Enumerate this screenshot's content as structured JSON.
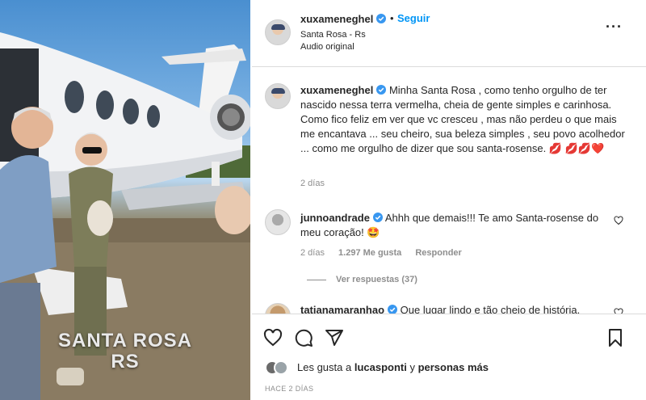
{
  "photo": {
    "overlay_line1": "SANTA ROSA",
    "overlay_line2": "RS"
  },
  "header": {
    "username": "xuxameneghel",
    "dot": "•",
    "follow_label": "Seguir",
    "location": "Santa Rosa - Rs",
    "audio": "Audio original",
    "more_label": "···"
  },
  "caption": {
    "username": "xuxameneghel",
    "text": " Minha Santa Rosa , como tenho orgulho de ter nascido nessa terra vermelha, cheia de gente simples e carinhosa. Como fico feliz em ver que vc cresceu , mas não perdeu o que mais me encantava ... seu cheiro, sua beleza simples , seu povo acolhedor ... como me orgulho de dizer que sou santa-rosense. 💋 💋💋❤️",
    "time": "2 días"
  },
  "comments": [
    {
      "username": "junnoandrade",
      "text": " Ahhh que demais!!! Te amo Santa-rosense do meu coração! 🤩",
      "time": "2 días",
      "likes": "1.297 Me gusta",
      "reply_label": "Responder",
      "view_replies": "Ver respuestas (37)"
    },
    {
      "username": "tatianamaranhao",
      "text": " Que lugar lindo e tão cheio de história."
    }
  ],
  "likes": {
    "prefix": "Les gusta a ",
    "user": "lucasponti",
    "middle": " y ",
    "rest": "personas más"
  },
  "date": "HACE 2 DÍAS",
  "colors": {
    "accent": "#0095f6",
    "text": "#262626",
    "muted": "#8e8e8e",
    "verified": "#3897f0"
  }
}
